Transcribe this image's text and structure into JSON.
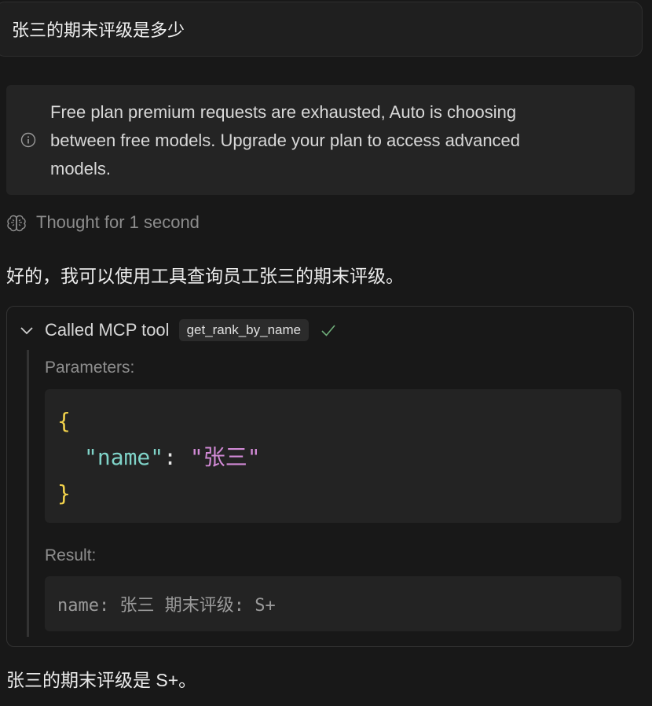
{
  "user_message": "张三的期末评级是多少",
  "notice": {
    "icon": "info-icon",
    "line1": "Free plan premium requests are exhausted, Auto is choosing",
    "line2": "between free models. Upgrade your plan to access advanced",
    "line3": "models."
  },
  "thought": {
    "icon": "brain-icon",
    "label": "Thought for 1 second"
  },
  "assistant_intro": "好的，我可以使用工具查询员工张三的期末评级。",
  "tool_call": {
    "title": "Called MCP tool",
    "tool_name": "get_rank_by_name",
    "status": "success",
    "parameters_label": "Parameters:",
    "params": {
      "open_brace": "{",
      "key": "\"name\"",
      "colon": ":",
      "value": "\"张三\"",
      "close_brace": "}"
    },
    "result_label": "Result:",
    "result": "name: 张三 期末评级: S+"
  },
  "assistant_final": "张三的期末评级是 S+。",
  "colors": {
    "background": "#181818",
    "brace": "#f2d24b",
    "json_key": "#7fd3c8",
    "json_string": "#d28ad6",
    "check": "#6fae7a"
  }
}
